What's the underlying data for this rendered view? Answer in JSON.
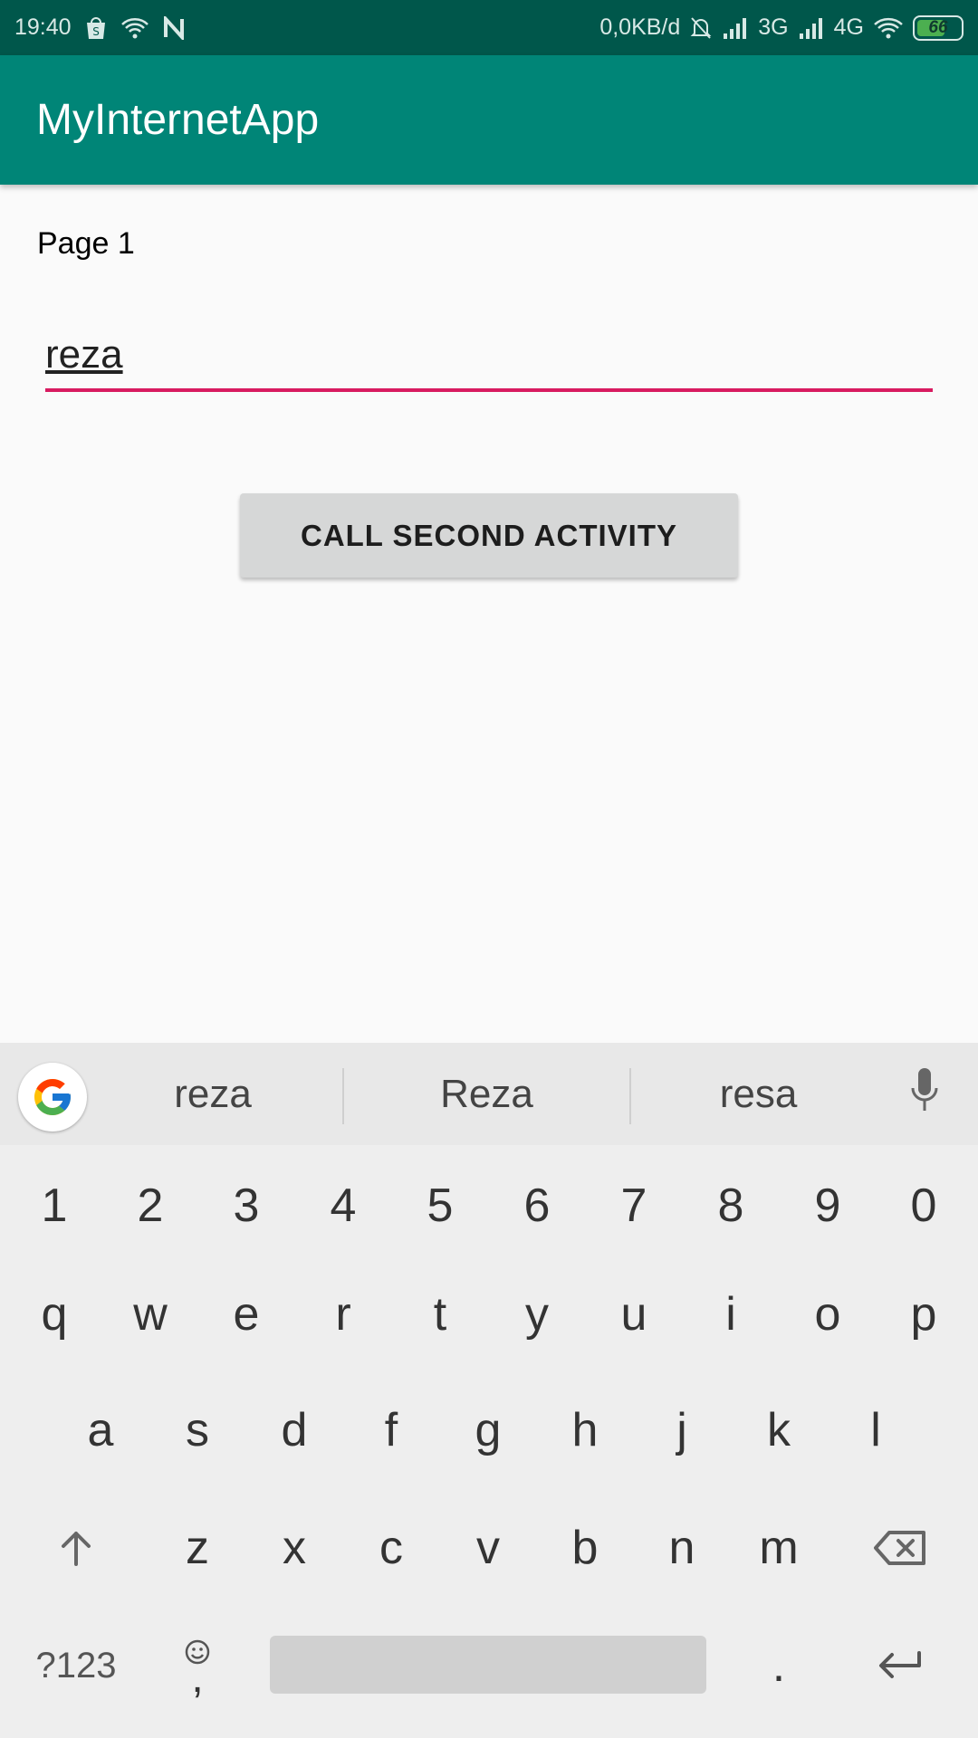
{
  "status_bar": {
    "time": "19:40",
    "network_speed": "0,0KB/d",
    "network_3g": "3G",
    "network_4g": "4G",
    "battery": "66",
    "icons": [
      "shopping-bag-icon",
      "wifi-icon",
      "n-icon",
      "bell-off-icon",
      "signal-icon",
      "signal-icon",
      "wifi-icon",
      "battery-icon"
    ]
  },
  "app_bar": {
    "title": "MyInternetApp"
  },
  "main": {
    "page_label": "Page 1",
    "input_value": "reza",
    "button_label": "CALL SECOND ACTIVITY",
    "accent_color": "#d81b60",
    "primary_color": "#008577",
    "primary_dark": "#00574b"
  },
  "keyboard": {
    "suggestions": [
      "reza",
      "Reza",
      "resa"
    ],
    "numbers": [
      "1",
      "2",
      "3",
      "4",
      "5",
      "6",
      "7",
      "8",
      "9",
      "0"
    ],
    "row1": [
      "q",
      "w",
      "e",
      "r",
      "t",
      "y",
      "u",
      "i",
      "o",
      "p"
    ],
    "row2": [
      "a",
      "s",
      "d",
      "f",
      "g",
      "h",
      "j",
      "k",
      "l"
    ],
    "row3": [
      "z",
      "x",
      "c",
      "v",
      "b",
      "n",
      "m"
    ],
    "symbols_key": "?123",
    "comma_key": ",",
    "period_key": "."
  }
}
